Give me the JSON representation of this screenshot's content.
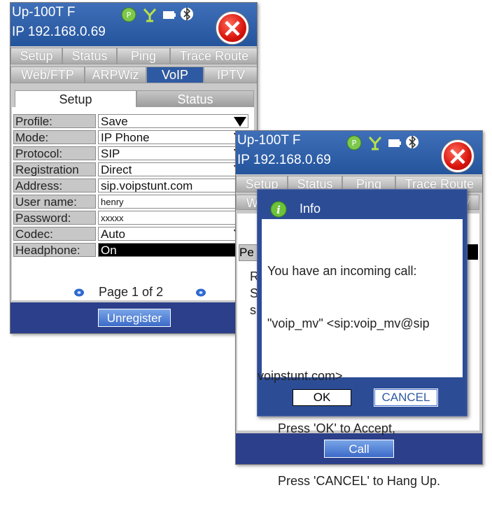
{
  "window1": {
    "title": "Up-100T F",
    "ip": "IP 192.168.0.69",
    "status_icons": [
      "power-icon",
      "network-icon",
      "battery-icon",
      "bluetooth-icon"
    ],
    "close_symbol": "✕",
    "tabs_row1": [
      "Setup",
      "Status",
      "Ping",
      "Trace Route"
    ],
    "tabs_row2": [
      "Web/FTP",
      "ARPWiz",
      "VoIP",
      "IPTV"
    ],
    "active_tab": "VoIP",
    "subtabs": {
      "setup": "Setup",
      "status": "Status"
    },
    "fields": [
      {
        "label": "Profile:",
        "value": "Save"
      },
      {
        "label": "Mode:",
        "value": "IP Phone"
      },
      {
        "label": "Protocol:",
        "value": "SIP"
      },
      {
        "label": "Registration",
        "value": "Direct"
      },
      {
        "label": "Address:",
        "value": "sip.voipstunt.com"
      },
      {
        "label": "User name:",
        "value": "henry"
      },
      {
        "label": "Password:",
        "value": "xxxxx"
      },
      {
        "label": "Codec:",
        "value": "Auto"
      },
      {
        "label": "Headphone:",
        "value": "On"
      }
    ],
    "page_text": "Page 1 of 2",
    "unregister_label": "Unregister"
  },
  "window2": {
    "title": "Up-100T F",
    "ip": "IP 192.168.0.69",
    "close_symbol": "✕",
    "tabs_row1": [
      "Setup",
      "Status",
      "Ping",
      "Trace Route"
    ],
    "tabs_row2_visible": [
      "W",
      "V"
    ],
    "partial_left": {
      "field_label": "Pe",
      "lines": [
        "R",
        "S",
        "s"
      ]
    },
    "call_label": "Call"
  },
  "dialog": {
    "title": "Info",
    "message_lines": [
      "You have an incoming call:",
      "\"voip_mv\" <sip:voip_mv@sip",
      "voipstunt.com>",
      "   Press 'OK' to Accept,",
      "   Press 'CANCEL' to Hang Up."
    ],
    "ok_label": "OK",
    "cancel_label": "CANCEL"
  },
  "colors": {
    "titlebar": "#2e5aa3",
    "bottombar": "#2c3f8a",
    "close": "#d8140c"
  }
}
